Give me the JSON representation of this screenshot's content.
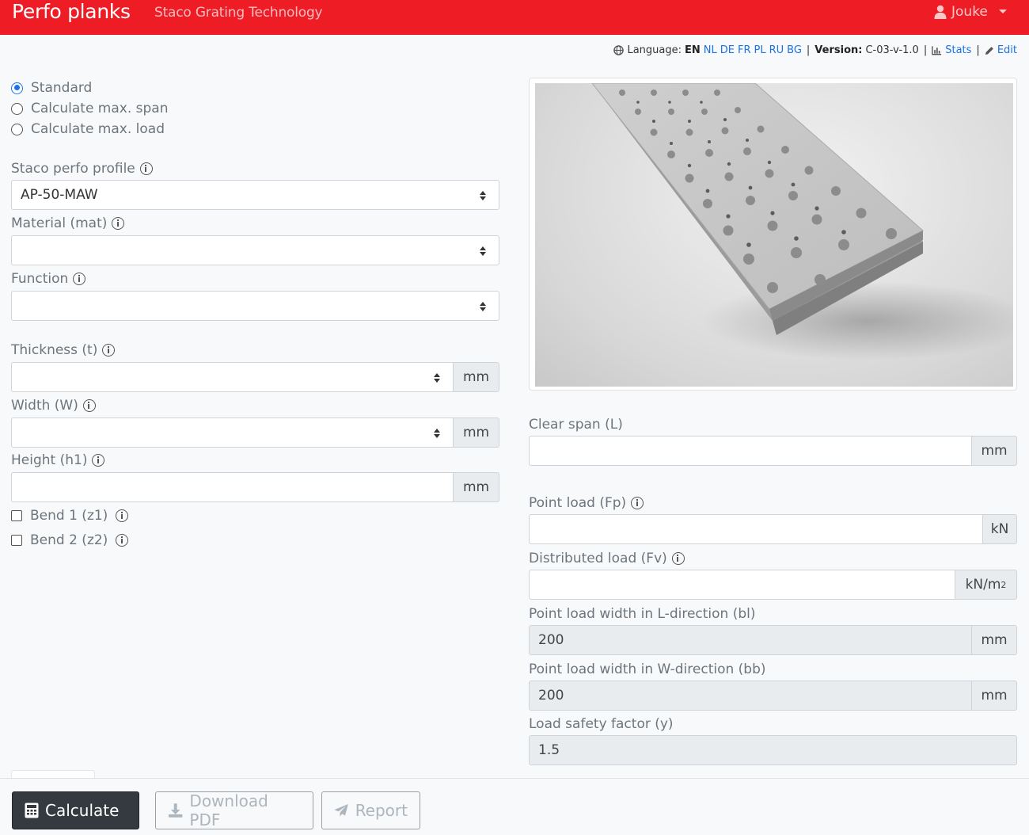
{
  "navbar": {
    "brand": "Perfo planks",
    "tagline": "Staco Grating Technology",
    "user": "Jouke"
  },
  "meta": {
    "language_label": "Language:",
    "languages": [
      "EN",
      "NL",
      "DE",
      "FR",
      "PL",
      "RU",
      "BG"
    ],
    "version_label": "Version:",
    "version_value": "C-03-v-1.0",
    "stats_label": "Stats",
    "edit_label": "Edit"
  },
  "mode": {
    "options": [
      "Standard",
      "Calculate max. span",
      "Calculate max. load"
    ],
    "selected": "Standard"
  },
  "left_form": {
    "profile_label": "Staco perfo profile",
    "profile_value": "AP-50-MAW",
    "material_label": "Material (mat)",
    "material_value": "",
    "function_label": "Function",
    "function_value": "",
    "thickness_label": "Thickness (t)",
    "thickness_unit": "mm",
    "width_label": "Width (W)",
    "width_unit": "mm",
    "height_label": "Height (h1)",
    "height_unit": "mm",
    "bend1_label": "Bend 1 (z1)",
    "bend2_label": "Bend 2 (z2)"
  },
  "right_form": {
    "clear_span_label": "Clear span (L)",
    "clear_span_unit": "mm",
    "point_load_label": "Point load (Fp)",
    "point_load_unit": "kN",
    "dist_load_label": "Distributed load (Fv)",
    "dist_load_unit": "kN/m",
    "dist_load_unit_sup": "2",
    "bl_label": "Point load width in L-direction (bl)",
    "bl_value": "200",
    "bl_unit": "mm",
    "bb_label": "Point load width in W-direction (bb)",
    "bb_value": "200",
    "bb_unit": "mm",
    "safety_label": "Load safety factor (y)",
    "safety_value": "1.5"
  },
  "footer": {
    "calculate": "Calculate",
    "download": "Download PDF",
    "report": "Report"
  },
  "colors": {
    "brand_red": "#ee1c25",
    "link_blue": "#1a73e8",
    "dark_button": "#343a40"
  }
}
